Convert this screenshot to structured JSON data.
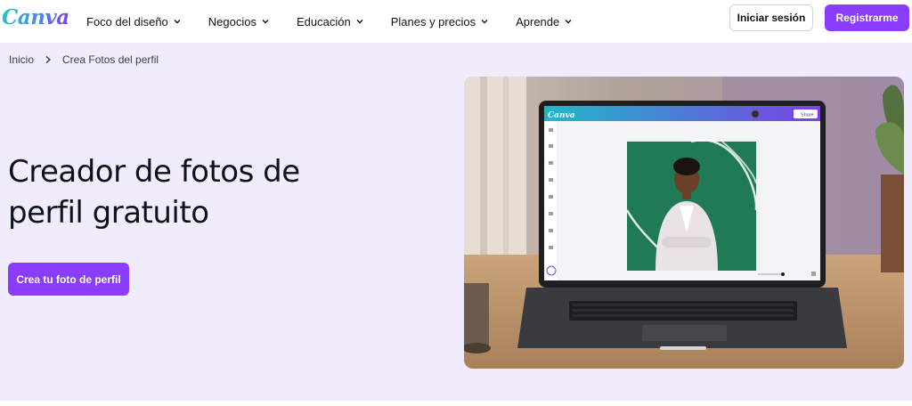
{
  "brand": {
    "logo_text": "Canva",
    "accent": "#8b3dff"
  },
  "nav": {
    "items": [
      {
        "label": "Foco del diseño"
      },
      {
        "label": "Negocios"
      },
      {
        "label": "Educación"
      },
      {
        "label": "Planes y precios"
      },
      {
        "label": "Aprende"
      }
    ],
    "login_label": "Iniciar sesión",
    "register_label": "Registrarme"
  },
  "breadcrumb": {
    "home": "Inicio",
    "current": "Crea Fotos del perfil"
  },
  "hero": {
    "title_line1": "Creador de fotos de",
    "title_line2": "perfil gratuito",
    "cta_label": "Crea tu foto de perfil"
  },
  "editor_mock": {
    "logo_text": "Canva",
    "share_label": "Share",
    "canvas_bg": "#1f7a55"
  }
}
